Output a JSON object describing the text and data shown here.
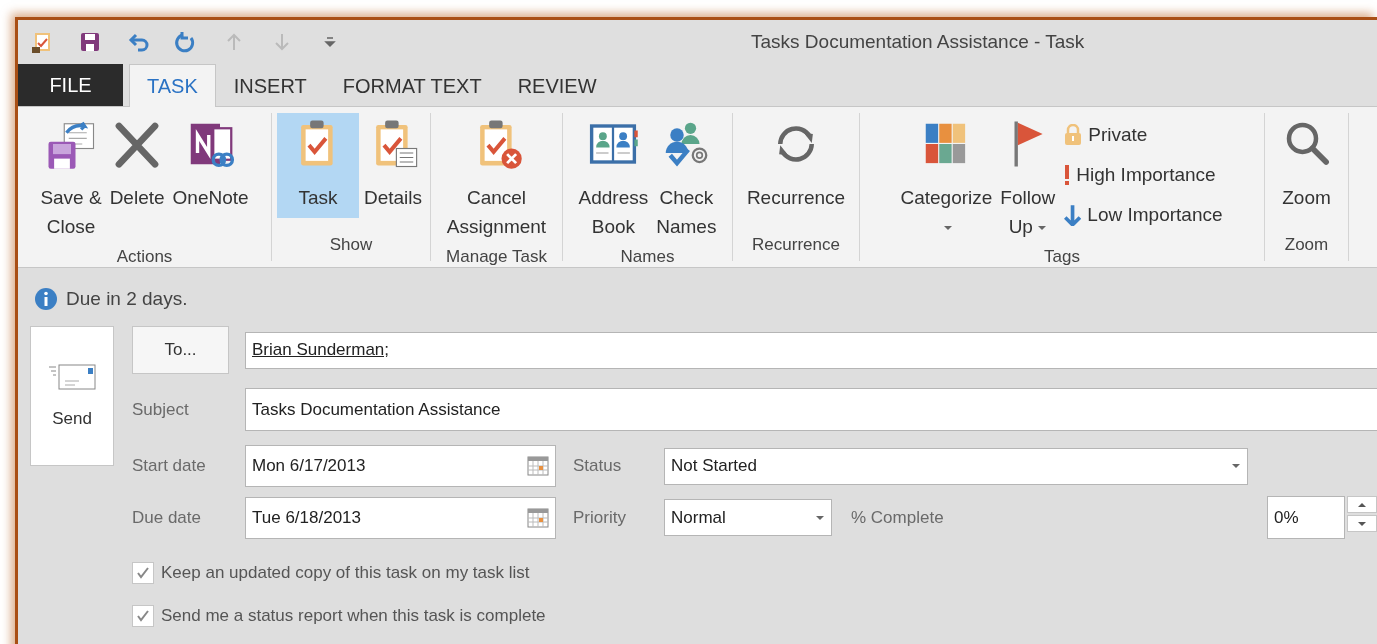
{
  "window": {
    "title": "Tasks Documentation Assistance - Task"
  },
  "quick_access": [
    {
      "kind": "app",
      "disabled": false
    },
    {
      "kind": "save",
      "disabled": false
    },
    {
      "kind": "undo",
      "disabled": false
    },
    {
      "kind": "redo",
      "disabled": false
    },
    {
      "kind": "up",
      "disabled": true
    },
    {
      "kind": "down",
      "disabled": true
    },
    {
      "kind": "customize",
      "disabled": false
    }
  ],
  "tabs": [
    {
      "label": "FILE",
      "kind": "file",
      "selected": false
    },
    {
      "label": "TASK",
      "kind": "tab",
      "selected": true
    },
    {
      "label": "INSERT",
      "kind": "tab",
      "selected": false
    },
    {
      "label": "FORMAT TEXT",
      "kind": "tab",
      "selected": false
    },
    {
      "label": "REVIEW",
      "kind": "tab",
      "selected": false
    }
  ],
  "ribbon": {
    "groups": [
      {
        "label": "Actions",
        "buttons": [
          {
            "kind": "big",
            "lines": [
              "Save &",
              "Close"
            ]
          },
          {
            "kind": "big",
            "lines": [
              "Delete"
            ]
          },
          {
            "kind": "big",
            "lines": [
              "OneNote"
            ]
          }
        ]
      },
      {
        "label": "Show",
        "buttons": [
          {
            "kind": "big",
            "lines": [
              "Task"
            ],
            "selected": true
          },
          {
            "kind": "big",
            "lines": [
              "Details"
            ],
            "selected": false
          }
        ]
      },
      {
        "label": "Manage Task",
        "buttons": [
          {
            "kind": "big",
            "lines": [
              "Cancel",
              "Assignment"
            ]
          }
        ]
      },
      {
        "label": "Names",
        "buttons": [
          {
            "kind": "big",
            "lines": [
              "Address",
              "Book"
            ]
          },
          {
            "kind": "big",
            "lines": [
              "Check",
              "Names"
            ]
          }
        ]
      },
      {
        "label": "Recurrence",
        "buttons": [
          {
            "kind": "big",
            "lines": [
              "Recurrence"
            ]
          }
        ]
      },
      {
        "label": "Tags",
        "buttons": [
          {
            "kind": "big",
            "lines": [
              "Categorize"
            ],
            "dropdown": true
          },
          {
            "kind": "big",
            "lines": [
              "Follow",
              "Up"
            ],
            "dropdown": true
          },
          {
            "kind": "small",
            "lines": [
              "Private"
            ]
          },
          {
            "kind": "small",
            "lines": [
              "High Importance"
            ]
          },
          {
            "kind": "small",
            "lines": [
              "Low Importance"
            ]
          }
        ]
      },
      {
        "label": "Zoom",
        "buttons": [
          {
            "kind": "big",
            "lines": [
              "Zoom"
            ]
          }
        ]
      }
    ]
  },
  "info": {
    "text": "Due in 2 days."
  },
  "send_button": {
    "label": "Send"
  },
  "to": {
    "button": "To...",
    "value": "Brian Sunderman;"
  },
  "subject": {
    "label": "Subject",
    "value": "Tasks Documentation Assistance"
  },
  "start_date": {
    "label": "Start date",
    "value": "Mon 6/17/2013"
  },
  "due_date": {
    "label": "Due date",
    "value": "Tue 6/18/2013"
  },
  "status": {
    "label": "Status",
    "value": "Not Started"
  },
  "priority": {
    "label": "Priority",
    "value": "Normal"
  },
  "percent_complete": {
    "label": "% Complete",
    "value": "0%"
  },
  "options": [
    {
      "label": "Keep an updated copy of this task on my task list",
      "checked": true
    },
    {
      "label": "Send me a status report when this task is complete",
      "checked": true
    }
  ]
}
